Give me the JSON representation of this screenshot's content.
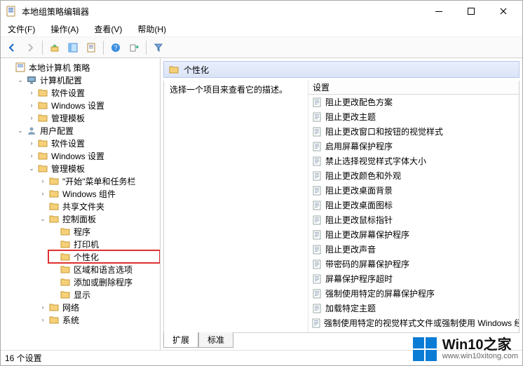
{
  "window": {
    "title": "本地组策略编辑器"
  },
  "menus": {
    "file": "文件(F)",
    "action": "操作(A)",
    "view": "查看(V)",
    "help": "帮助(H)"
  },
  "tree": {
    "root": "本地计算机 策略",
    "computer": "计算机配置",
    "c_soft": "软件设置",
    "c_win": "Windows 设置",
    "c_tmpl": "管理模板",
    "user": "用户配置",
    "u_soft": "软件设置",
    "u_win": "Windows 设置",
    "u_tmpl": "管理模板",
    "start": "\"开始\"菜单和任务栏",
    "wincomp": "Windows 组件",
    "shared": "共享文件夹",
    "cpanel": "控制面板",
    "programs": "程序",
    "printers": "打印机",
    "personalize": "个性化",
    "region": "区域和语言选项",
    "addremove": "添加或删除程序",
    "display": "显示",
    "network": "网络",
    "system": "系统"
  },
  "detail": {
    "header": "个性化",
    "desc": "选择一个项目来查看它的描述。",
    "column": "设置",
    "items": [
      "阻止更改配色方案",
      "阻止更改主题",
      "阻止更改窗口和按钮的视觉样式",
      "启用屏幕保护程序",
      "禁止选择视觉样式字体大小",
      "阻止更改颜色和外观",
      "阻止更改桌面背景",
      "阻止更改桌面图标",
      "阻止更改鼠标指针",
      "阻止更改屏幕保护程序",
      "阻止更改声音",
      "带密码的屏幕保护程序",
      "屏幕保护程序超时",
      "强制使用特定的屏幕保护程序",
      "加载特定主题",
      "强制使用特定的视觉样式文件或强制使用 Windows 经典"
    ]
  },
  "tabs": {
    "extended": "扩展",
    "standard": "标准"
  },
  "status": "16 个设置",
  "watermark": {
    "brand": "Win10之家",
    "url": "www.win10xitong.com"
  }
}
